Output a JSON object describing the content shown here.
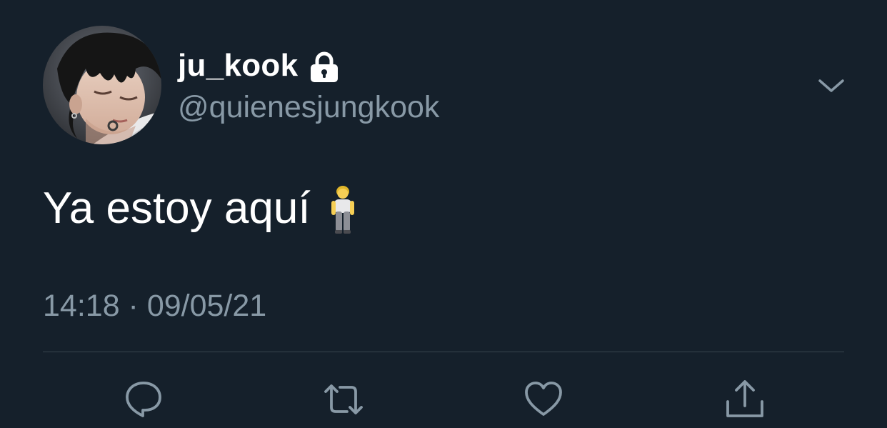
{
  "user": {
    "display_name": "ju_kook",
    "handle": "@quienesjungkook",
    "protected": true,
    "lock_icon": "lock-icon",
    "avatar": "profile-photo"
  },
  "tweet": {
    "text": "Ya estoy aquí",
    "emoji": "person-standing-emoji",
    "timestamp": "14:18 · 09/05/21"
  },
  "actions": [
    {
      "name": "reply",
      "icon": "comment-icon"
    },
    {
      "name": "retweet",
      "icon": "retweet-icon"
    },
    {
      "name": "like",
      "icon": "heart-icon"
    },
    {
      "name": "share",
      "icon": "share-icon"
    }
  ],
  "colors": {
    "background": "#15202b",
    "primary_text": "#ffffff",
    "secondary_text": "#8899a6",
    "divider": "#38444d"
  }
}
